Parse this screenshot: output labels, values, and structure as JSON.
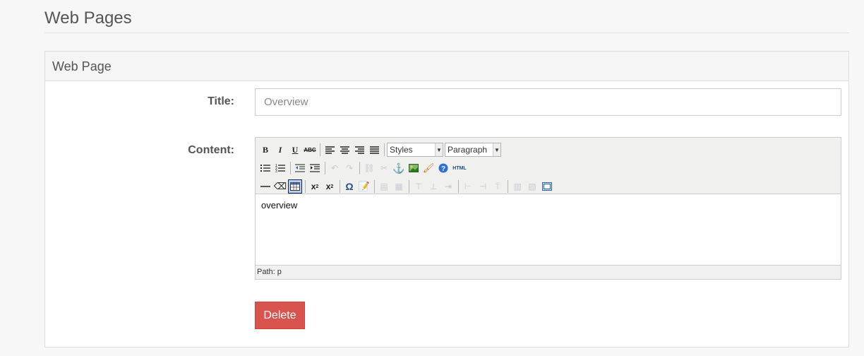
{
  "page": {
    "title": "Web Pages"
  },
  "panel": {
    "heading": "Web Page"
  },
  "form": {
    "title_label": "Title:",
    "title_value": "Overview",
    "content_label": "Content:"
  },
  "editor": {
    "styles_select": "Styles",
    "format_select": "Paragraph",
    "html_button": "HTML",
    "content_text": "overview",
    "path_text": "Path: p"
  },
  "actions": {
    "delete_label": "Delete"
  },
  "colors": {
    "delete_bg": "#d9534f",
    "link_icon": "#3366cc"
  }
}
